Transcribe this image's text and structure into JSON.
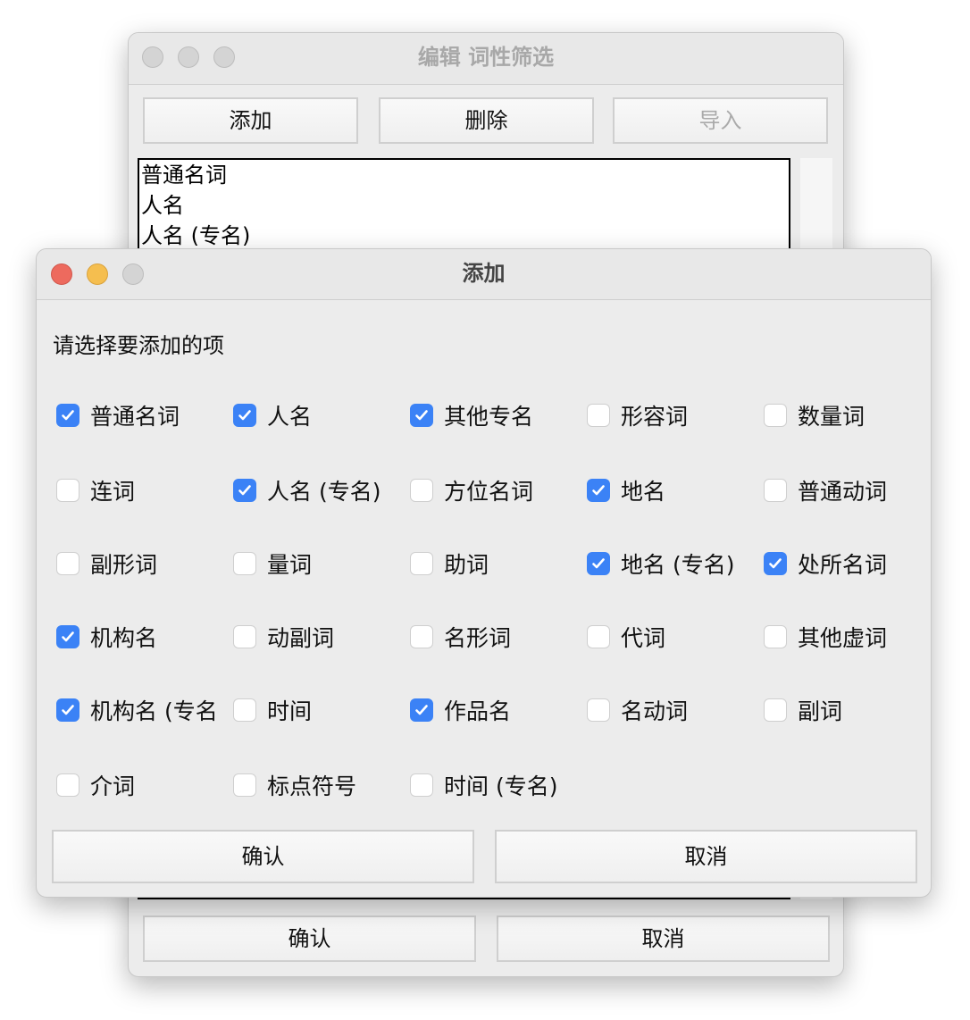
{
  "back_window": {
    "title": "编辑 词性筛选",
    "buttons": {
      "add": "添加",
      "delete": "删除",
      "import": "导入"
    },
    "list_items": [
      "普通名词",
      "人名",
      "人名 (专名)"
    ],
    "confirm": "确认",
    "cancel": "取消"
  },
  "dialog": {
    "title": "添加",
    "prompt": "请选择要添加的项",
    "accent_color": "#3b82f6",
    "options": [
      {
        "label": "普通名词",
        "checked": true
      },
      {
        "label": "人名",
        "checked": true
      },
      {
        "label": "其他专名",
        "checked": true
      },
      {
        "label": "形容词",
        "checked": false
      },
      {
        "label": "数量词",
        "checked": false
      },
      {
        "label": "连词",
        "checked": false
      },
      {
        "label": "人名 (专名)",
        "checked": true
      },
      {
        "label": "方位名词",
        "checked": false
      },
      {
        "label": "地名",
        "checked": true
      },
      {
        "label": "普通动词",
        "checked": false
      },
      {
        "label": "副形词",
        "checked": false
      },
      {
        "label": "量词",
        "checked": false
      },
      {
        "label": "助词",
        "checked": false
      },
      {
        "label": "地名 (专名)",
        "checked": true
      },
      {
        "label": "处所名词",
        "checked": true
      },
      {
        "label": "机构名",
        "checked": true
      },
      {
        "label": "动副词",
        "checked": false
      },
      {
        "label": "名形词",
        "checked": false
      },
      {
        "label": "代词",
        "checked": false
      },
      {
        "label": "其他虚词",
        "checked": false
      },
      {
        "label": "机构名 (专名",
        "checked": true
      },
      {
        "label": "时间",
        "checked": false
      },
      {
        "label": "作品名",
        "checked": true
      },
      {
        "label": "名动词",
        "checked": false
      },
      {
        "label": "副词",
        "checked": false
      },
      {
        "label": "介词",
        "checked": false
      },
      {
        "label": "标点符号",
        "checked": false
      },
      {
        "label": "时间 (专名)",
        "checked": false
      }
    ],
    "confirm": "确认",
    "cancel": "取消"
  }
}
